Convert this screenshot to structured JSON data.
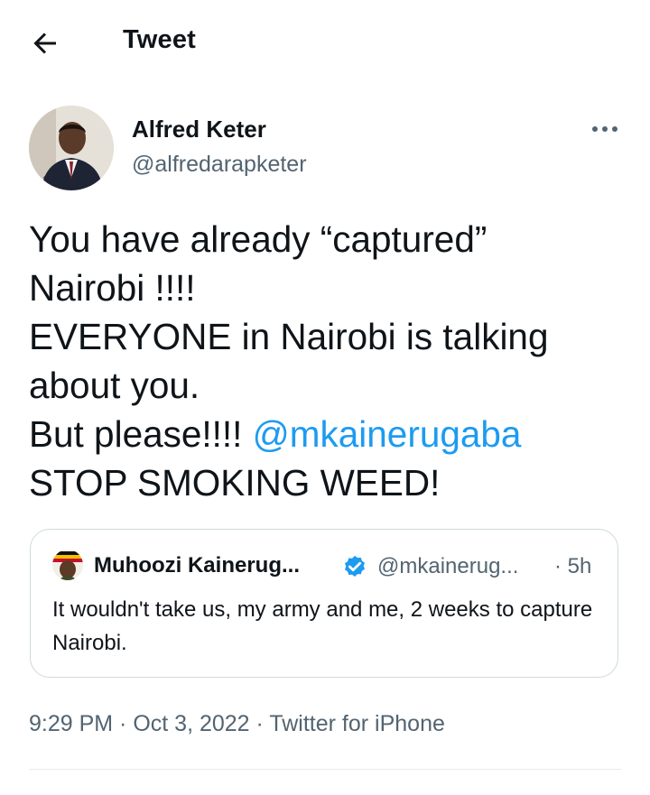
{
  "header": {
    "title": "Tweet",
    "back_icon": "arrow-left-icon"
  },
  "author": {
    "name": "Alfred Keter",
    "handle": "@alfredarapketer"
  },
  "tweet": {
    "lines": [
      "You have already “captured”",
      "Nairobi !!!!",
      "EVERYONE in Nairobi is talking",
      "about you.",
      "But please!!!! "
    ],
    "mention": "@mkainerugaba",
    "last_line": "STOP SMOKING WEED!"
  },
  "quote": {
    "name": "Muhoozi Kainerug...",
    "handle": "@mkainerug...",
    "time": "· 5h",
    "text": "It wouldn't take us, my army and me, 2 weeks to capture Nairobi."
  },
  "meta": {
    "time": "9:29 PM",
    "sep1": " · ",
    "date": "Oct 3, 2022",
    "sep2": " · ",
    "source": "Twitter for iPhone"
  },
  "colors": {
    "accent": "#1d9bf0",
    "text": "#0f1419",
    "secondary": "#536471",
    "border": "#cfd9de"
  }
}
